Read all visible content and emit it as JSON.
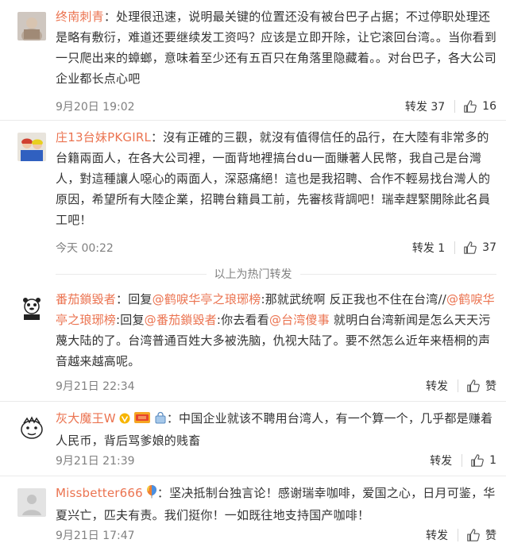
{
  "comments": [
    {
      "name": "终南刺青",
      "text": "：处理很迅速，说明最关键的位置还没有被台巴子占据；不过停职处理还是略有敷衍，难道还要继续发工资吗？应该是立即开除，让它滚回台湾。。当你看到一只爬出来的蟑螂，意味着至少还有五百只在角落里隐藏着。。对台巴子，各大公司企业都长点心吧",
      "time": "9月20日 19:02",
      "repost": "转发 37",
      "likes": "16"
    },
    {
      "name": "庄13台妹PKGIRL",
      "text": "：沒有正確的三觀，就沒有值得信任的品行，在大陸有非常多的台籍兩面人，在各大公司裡，一面背地裡搞台du一面賺著人民幣，我自己是台灣人，對這種讓人噁心的兩面人，深惡痛絕！這也是我招聘、合作不輕易找台灣人的原因，希望所有大陸企業，招聘台籍員工前，先審核背調吧！瑞幸趕緊開除此名員工吧！",
      "time": "今天 00:22",
      "repost": "转发 1",
      "likes": "37"
    }
  ],
  "hot_divider": "以上为热门转发",
  "reposts": [
    {
      "name": "番茄鎖毀者",
      "segments": [
        {
          "kind": "text",
          "value": "：回复"
        },
        {
          "kind": "mention",
          "value": "@鹤唳华亭之琅琊榜"
        },
        {
          "kind": "text",
          "value": ":那就武统啊 反正我也不住在台湾//"
        },
        {
          "kind": "mention",
          "value": "@鹤唳华亭之琅琊榜"
        },
        {
          "kind": "text",
          "value": ":回复"
        },
        {
          "kind": "mention",
          "value": "@番茄鎖毀者"
        },
        {
          "kind": "text",
          "value": ":你去看看"
        },
        {
          "kind": "mention",
          "value": "@台湾傻事"
        },
        {
          "kind": "text",
          "value": " 就明白台湾新闻是怎么天天污蔑大陆的了。台湾普通百姓大多被洗脑，仇视大陆了。要不然怎么近年来梧桐的声音越来越高呢。"
        }
      ],
      "time": "9月21日 22:34",
      "repost": "转发",
      "likes": "赞"
    },
    {
      "name": "灰大魔王W",
      "text": "：中国企业就该不聘用台湾人，有一个算一个，几乎都是赚着人民币，背后骂爹娘的贱畜",
      "time": "9月21日 21:39",
      "repost": "转发",
      "likes": "1"
    },
    {
      "name": "Missbetter666",
      "text": "：坚决抵制台独言论！感谢瑞幸咖啡，爱国之心，日月可鉴，华夏兴亡，匹夫有责。我们挺你！一如既往地支持国产咖啡！",
      "time": "9月21日 17:47",
      "repost": "转发",
      "likes": "赞"
    }
  ],
  "icons": {
    "like": "thumbs-up-icon",
    "vip": "v-badge-icon",
    "member": "member-badge-icon",
    "balloon": "balloon-icon"
  },
  "colors": {
    "name": "#eb7350",
    "text": "#333333",
    "meta": "#808080",
    "divider": "#eaeaea"
  }
}
